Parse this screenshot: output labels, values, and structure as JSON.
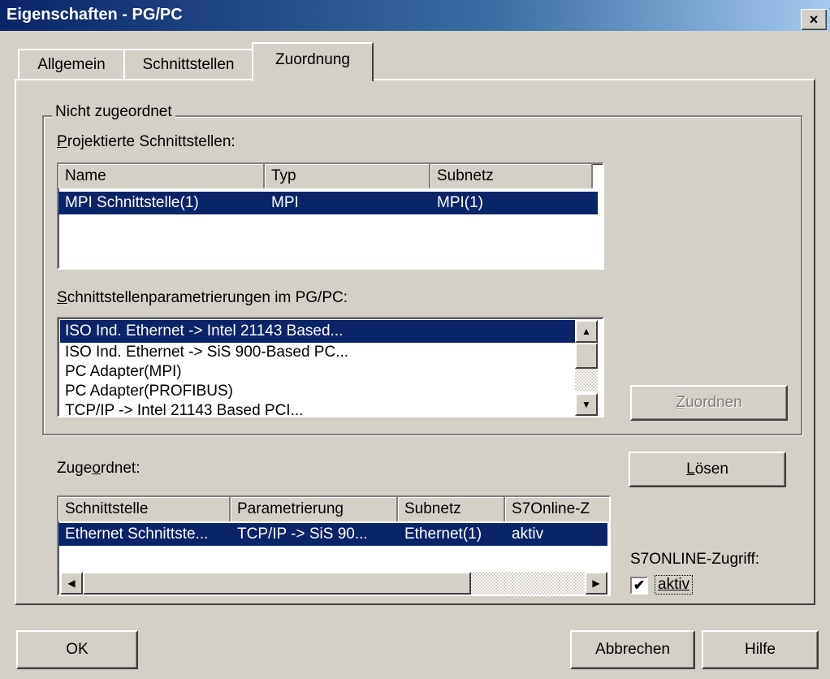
{
  "window": {
    "title": "Eigenschaften - PG/PC",
    "close_glyph": "×"
  },
  "tabs": [
    {
      "label": "Allgemein",
      "active": false
    },
    {
      "label": "Schnittstellen",
      "active": false
    },
    {
      "label": "Zuordnung",
      "active": true
    }
  ],
  "not_assigned": {
    "group_label": "Nicht zugeordnet",
    "configured_label_mnemonic": "P",
    "configured_label_rest": "rojektierte Schnittstellen:",
    "configured_columns": [
      "Name",
      "Typ",
      "Subnetz"
    ],
    "configured_rows": [
      {
        "name": "MPI Schnittstelle(1)",
        "typ": "MPI",
        "subnetz": "MPI(1)",
        "selected": true
      }
    ],
    "params_label_mnemonic": "S",
    "params_label_rest": "chnittstellenparametrierungen im PG/PC:",
    "params_items": [
      {
        "label": "ISO Ind. Ethernet -> Intel 21143 Based...",
        "selected": true
      },
      {
        "label": "ISO Ind. Ethernet -> SiS 900-Based PC...",
        "selected": false
      },
      {
        "label": "PC Adapter(MPI)",
        "selected": false
      },
      {
        "label": "PC Adapter(PROFIBUS)",
        "selected": false
      },
      {
        "label": "TCP/IP -> Intel 21143 Based PCI...",
        "selected": false
      }
    ],
    "assign_button_mnemonic": "Z",
    "assign_button_rest": "uordnen"
  },
  "assigned": {
    "label_pre": "Zuge",
    "label_mnemonic": "o",
    "label_post": "rdnet:",
    "columns": [
      "Schnittstelle",
      "Parametrierung",
      "Subnetz",
      "S7Online-Z"
    ],
    "rows": [
      {
        "schnittstelle": "Ethernet Schnittste...",
        "parametrierung": "TCP/IP -> SiS 90...",
        "subnetz": "Ethernet(1)",
        "s7online": "aktiv",
        "selected": true
      }
    ],
    "release_button_mnemonic": "L",
    "release_button_rest": "ösen",
    "s7online_label": "S7ONLINE-Zugriff:",
    "s7online_checkbox_label": "aktiv",
    "s7online_checked": true
  },
  "footer": {
    "ok": "OK",
    "cancel": "Abbrechen",
    "help": "Hilfe"
  },
  "glyphs": {
    "up": "▲",
    "down": "▼",
    "left": "◀",
    "right": "▶",
    "check": "✔"
  }
}
